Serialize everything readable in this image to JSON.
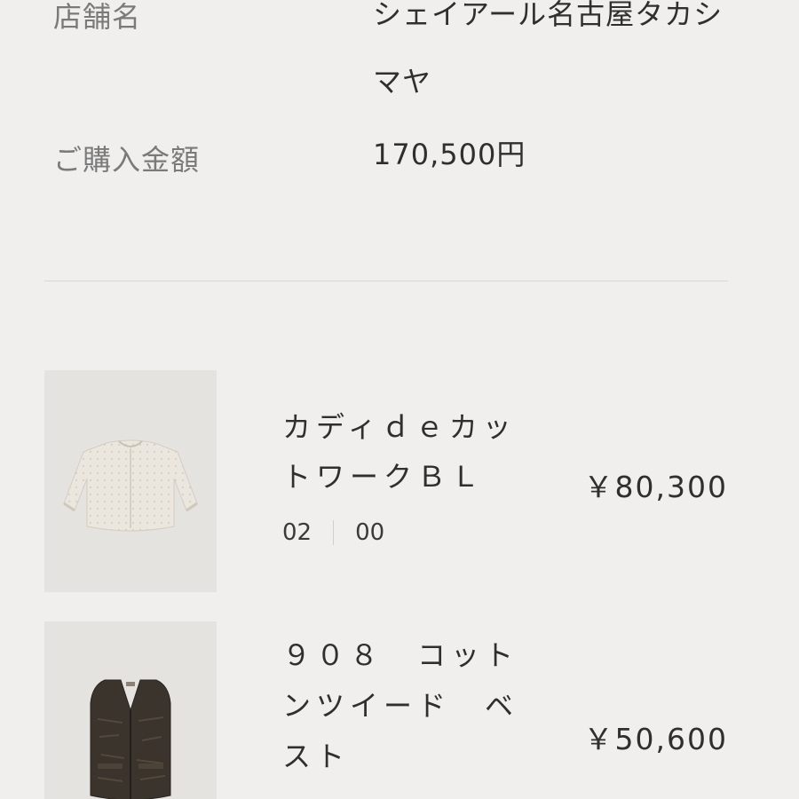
{
  "purchase_info": {
    "store_label": "店舗名",
    "store_value": "シェイアール名古屋タカシマヤ",
    "amount_label": "ご購入金額",
    "amount_value": "170,500円"
  },
  "items": [
    {
      "name": "カディｄｅカットワークＢＬ",
      "options": [
        "02",
        "00"
      ],
      "price": "￥80,300",
      "image_icon": "blouse-image"
    },
    {
      "name": "９０８　コットンツイード　ベスト",
      "price": "￥50,600",
      "image_icon": "vest-image"
    }
  ],
  "colors": {
    "background": "#f0efed",
    "thumbnail_bg": "#e4e3e0",
    "label_text": "#7a7a7a",
    "body_text": "#2f2f2f",
    "divider": "#d9d8d5"
  }
}
